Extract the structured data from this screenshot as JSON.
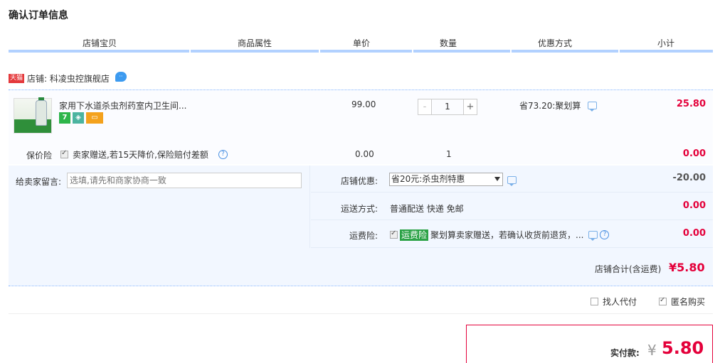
{
  "page_title": "确认订单信息",
  "columns": [
    "店铺宝贝",
    "商品属性",
    "单价",
    "数量",
    "优惠方式",
    "小计"
  ],
  "shop": {
    "badge": "天猫",
    "label": "店铺: 科凌虫控旗舰店",
    "icon": "wangwang-icon"
  },
  "item": {
    "title": "家用下水道杀虫剂药室内卫生间...",
    "service_icons": [
      "seven-day-return-icon",
      "shield-icon",
      "credit-card-icon"
    ],
    "seven_label": "7",
    "price": "99.00",
    "quantity": "1",
    "minus": "-",
    "plus": "+",
    "discount": "省73.20:聚划算",
    "subtotal": "25.80"
  },
  "insurance": {
    "label": "保价险",
    "desc": "卖家赠送,若15天降价,保险赔付差额",
    "price": "0.00",
    "qty": "1",
    "subtotal": "0.00",
    "help": "?"
  },
  "memo": {
    "label": "给卖家留言:",
    "placeholder": "选填,请先和商家协商一致"
  },
  "shop_promo": {
    "label": "店铺优惠:",
    "selected": "省20元:杀虫剂特惠",
    "value": "-20.00"
  },
  "shipping": {
    "label": "运送方式:",
    "value": "普通配送 快递 免邮",
    "amount": "0.00"
  },
  "shipping_ins": {
    "label": "运费险:",
    "badge": "运费险",
    "desc": "聚划算卖家赠送，若确认收货前退货，...",
    "amount": "0.00"
  },
  "shop_total": {
    "label": "店铺合计(含运费)",
    "value": "¥5.80"
  },
  "options": {
    "proxy_pay": "找人代付",
    "anonymous": "匿名购买"
  },
  "payment": {
    "label": "实付款:",
    "yen": "¥",
    "value": "5.80"
  },
  "colors": {
    "accent_red": "#e4003a",
    "header_bar": "#b2d1ff",
    "panel": "#f2f7ff"
  }
}
